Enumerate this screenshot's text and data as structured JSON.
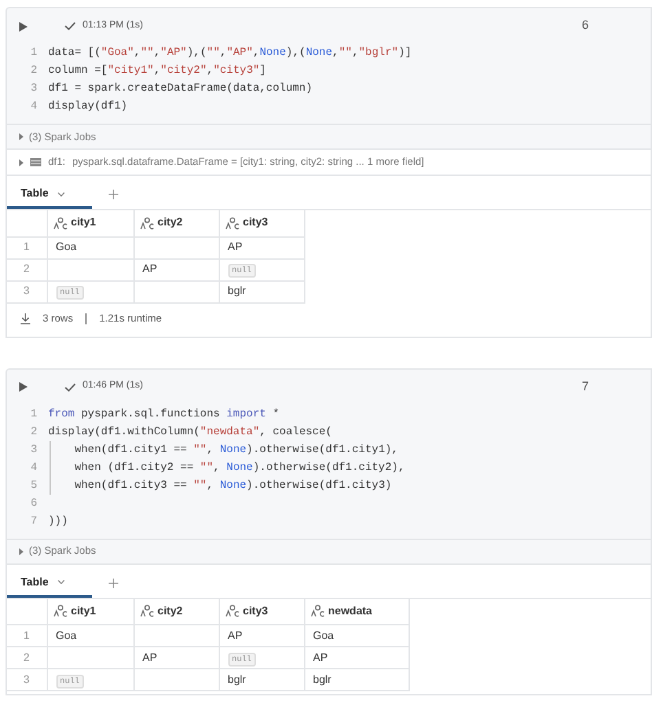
{
  "cells": [
    {
      "status": "01:13 PM (1s)",
      "number": "6",
      "code": [
        {
          "number": "1",
          "guide": false,
          "tokens": [
            {
              "kind": "plain",
              "text": "data= [("
            },
            {
              "kind": "str",
              "text": "\"Goa\""
            },
            {
              "kind": "plain",
              "text": ","
            },
            {
              "kind": "str",
              "text": "\"\""
            },
            {
              "kind": "plain",
              "text": ","
            },
            {
              "kind": "str",
              "text": "\"AP\""
            },
            {
              "kind": "plain",
              "text": "),("
            },
            {
              "kind": "str",
              "text": "\"\""
            },
            {
              "kind": "plain",
              "text": ","
            },
            {
              "kind": "str",
              "text": "\"AP\""
            },
            {
              "kind": "plain",
              "text": ","
            },
            {
              "kind": "kw",
              "text": "None"
            },
            {
              "kind": "plain",
              "text": "),("
            },
            {
              "kind": "kw",
              "text": "None"
            },
            {
              "kind": "plain",
              "text": ","
            },
            {
              "kind": "str",
              "text": "\"\""
            },
            {
              "kind": "plain",
              "text": ","
            },
            {
              "kind": "str",
              "text": "\"bglr\""
            },
            {
              "kind": "plain",
              "text": ")]"
            }
          ]
        },
        {
          "number": "2",
          "guide": false,
          "tokens": [
            {
              "kind": "plain",
              "text": "column =["
            },
            {
              "kind": "str",
              "text": "\"city1\""
            },
            {
              "kind": "plain",
              "text": ","
            },
            {
              "kind": "str",
              "text": "\"city2\""
            },
            {
              "kind": "plain",
              "text": ","
            },
            {
              "kind": "str",
              "text": "\"city3\""
            },
            {
              "kind": "plain",
              "text": "]"
            }
          ]
        },
        {
          "number": "3",
          "guide": false,
          "tokens": [
            {
              "kind": "plain",
              "text": "df1 = spark.createDataFrame(data,column)"
            }
          ]
        },
        {
          "number": "4",
          "guide": false,
          "tokens": [
            {
              "kind": "plain",
              "text": "display(df1)"
            }
          ]
        }
      ],
      "spark_jobs": "(3) Spark Jobs",
      "schema": {
        "name": "df1:",
        "type": "pyspark.sql.dataframe.DataFrame = [city1: string, city2: string ... 1 more field]"
      },
      "tabs": [
        {
          "label": "Table",
          "selected": true
        }
      ],
      "table": {
        "columns": [
          "city1",
          "city2",
          "city3"
        ],
        "rows": [
          {
            "index": "1",
            "cells": [
              {
                "kind": "text",
                "text": "Goa"
              },
              {
                "kind": "empty"
              },
              {
                "kind": "text",
                "text": "AP"
              }
            ]
          },
          {
            "index": "2",
            "cells": [
              {
                "kind": "empty"
              },
              {
                "kind": "text",
                "text": "AP"
              },
              {
                "kind": "null",
                "text": "null"
              }
            ]
          },
          {
            "index": "3",
            "cells": [
              {
                "kind": "null",
                "text": "null"
              },
              {
                "kind": "empty"
              },
              {
                "kind": "text",
                "text": "bglr"
              }
            ]
          }
        ]
      },
      "footer": {
        "rows": "3 rows",
        "runtime": "1.21s runtime"
      }
    },
    {
      "status": "01:46 PM (1s)",
      "number": "7",
      "code": [
        {
          "number": "1",
          "guide": false,
          "tokens": [
            {
              "kind": "imp",
              "text": "from"
            },
            {
              "kind": "plain",
              "text": " pyspark.sql.functions "
            },
            {
              "kind": "imp",
              "text": "import"
            },
            {
              "kind": "plain",
              "text": " *"
            }
          ]
        },
        {
          "number": "2",
          "guide": false,
          "tokens": [
            {
              "kind": "plain",
              "text": "display(df1.withColumn("
            },
            {
              "kind": "str",
              "text": "\"newdata\""
            },
            {
              "kind": "plain",
              "text": ", coalesce("
            }
          ]
        },
        {
          "number": "3",
          "guide": true,
          "tokens": [
            {
              "kind": "plain",
              "text": "    when(df1.city1 == "
            },
            {
              "kind": "str",
              "text": "\"\""
            },
            {
              "kind": "plain",
              "text": ", "
            },
            {
              "kind": "kw",
              "text": "None"
            },
            {
              "kind": "plain",
              "text": ").otherwise(df1.city1),"
            }
          ]
        },
        {
          "number": "4",
          "guide": true,
          "tokens": [
            {
              "kind": "plain",
              "text": "    when (df1.city2 == "
            },
            {
              "kind": "str",
              "text": "\"\""
            },
            {
              "kind": "plain",
              "text": ", "
            },
            {
              "kind": "kw",
              "text": "None"
            },
            {
              "kind": "plain",
              "text": ").otherwise(df1.city2),"
            }
          ]
        },
        {
          "number": "5",
          "guide": true,
          "tokens": [
            {
              "kind": "plain",
              "text": "    when(df1.city3 == "
            },
            {
              "kind": "str",
              "text": "\"\""
            },
            {
              "kind": "plain",
              "text": ", "
            },
            {
              "kind": "kw",
              "text": "None"
            },
            {
              "kind": "plain",
              "text": ").otherwise(df1.city3)"
            }
          ]
        },
        {
          "number": "6",
          "guide": false
        },
        {
          "number": "7",
          "guide": false,
          "tokens": [
            {
              "kind": "plain",
              "text": ")))"
            }
          ]
        }
      ],
      "spark_jobs": "(3) Spark Jobs",
      "tabs": [
        {
          "label": "Table",
          "selected": true
        }
      ],
      "table": {
        "columns": [
          "city1",
          "city2",
          "city3",
          "newdata"
        ],
        "rows": [
          {
            "index": "1",
            "cells": [
              {
                "kind": "text",
                "text": "Goa"
              },
              {
                "kind": "empty"
              },
              {
                "kind": "text",
                "text": "AP"
              },
              {
                "kind": "text",
                "text": "Goa"
              }
            ]
          },
          {
            "index": "2",
            "cells": [
              {
                "kind": "empty"
              },
              {
                "kind": "text",
                "text": "AP"
              },
              {
                "kind": "null",
                "text": "null"
              },
              {
                "kind": "text",
                "text": "AP"
              }
            ]
          },
          {
            "index": "3",
            "cells": [
              {
                "kind": "null",
                "text": "null"
              },
              {
                "kind": "empty"
              },
              {
                "kind": "text",
                "text": "bglr"
              },
              {
                "kind": "text",
                "text": "bglr"
              }
            ]
          }
        ]
      }
    }
  ]
}
